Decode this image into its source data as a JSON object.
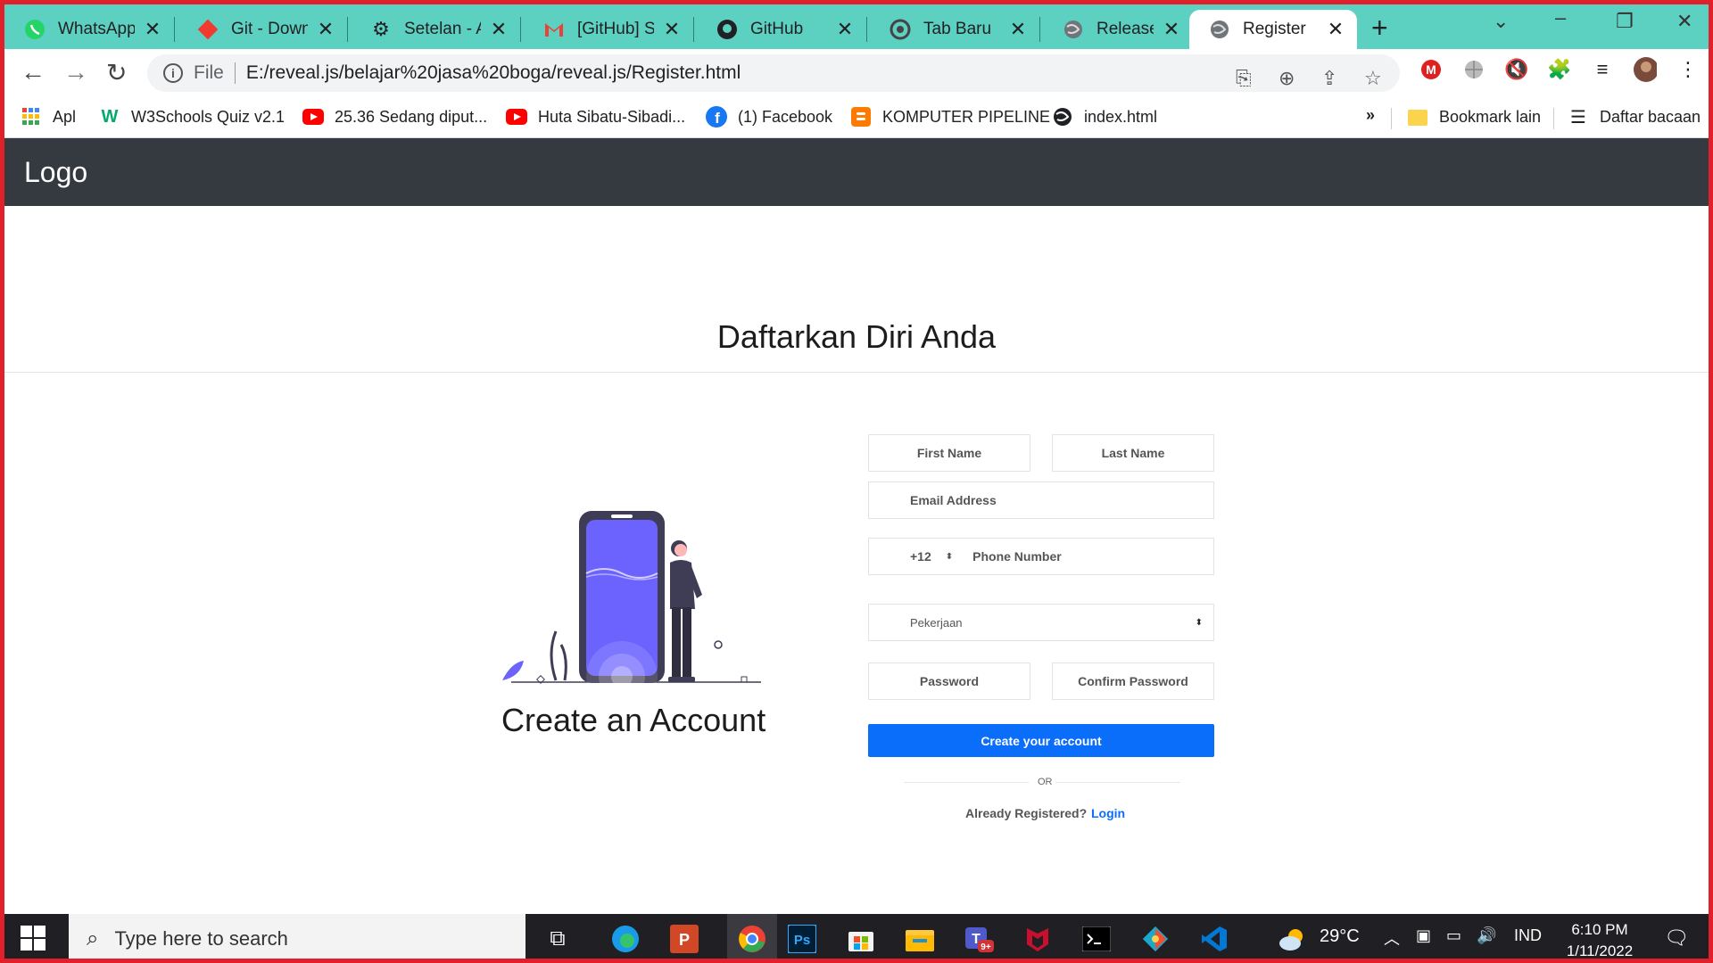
{
  "browser": {
    "tabs": [
      {
        "title": "WhatsApp",
        "icon": "whatsapp-icon"
      },
      {
        "title": "Git - Downl",
        "icon": "git-icon"
      },
      {
        "title": "Setelan - Al",
        "icon": "settings-gear-icon"
      },
      {
        "title": "[GitHub] Si",
        "icon": "gmail-icon"
      },
      {
        "title": "GitHub",
        "icon": "github-icon"
      },
      {
        "title": "Tab Baru",
        "icon": "chrome-icon"
      },
      {
        "title": "ReleaseNot",
        "icon": "globe-icon"
      },
      {
        "title": "Register",
        "icon": "globe-icon",
        "active": true
      }
    ],
    "new_tab_label": "+",
    "address": {
      "scheme_label": "File",
      "url": "E:/reveal.js/belajar%20jasa%20boga/reveal.js/Register.html"
    },
    "bookmarks": [
      {
        "label": "Apl",
        "icon": "apps-grid-icon"
      },
      {
        "label": "W3Schools Quiz v2.1",
        "icon": "w3schools-icon"
      },
      {
        "label": "25.36 Sedang diput...",
        "icon": "youtube-icon"
      },
      {
        "label": "Huta Sibatu-Sibadi...",
        "icon": "youtube-icon"
      },
      {
        "label": "(1) Facebook",
        "icon": "facebook-icon"
      },
      {
        "label": "KOMPUTER PIPELINE",
        "icon": "blogger-icon"
      },
      {
        "label": "index.html",
        "icon": "globe-icon"
      }
    ],
    "bookmarks_more": "»",
    "other_bookmarks": "Bookmark lain",
    "reading_list": "Daftar bacaan"
  },
  "site": {
    "logo": "Logo",
    "heading": "Daftarkan Diri Anda",
    "illustration_caption": "Create an Account",
    "form": {
      "first_name": "First Name",
      "last_name": "Last Name",
      "email": "Email Address",
      "country_code": "+12",
      "phone": "Phone Number",
      "job_select": "Pekerjaan",
      "password": "Password",
      "confirm_password": "Confirm Password",
      "submit": "Create your account",
      "or": "OR",
      "already": "Already Registered?",
      "login": "Login"
    }
  },
  "taskbar": {
    "search_placeholder": "Type here to search",
    "weather": "29°C",
    "language": "IND",
    "time": "6:10 PM",
    "date": "1/11/2022",
    "teams_badge": "9+"
  },
  "colors": {
    "tab_strip": "#5cd0c1",
    "navbar": "#343a40",
    "primary": "#0a6efb",
    "illustration": "#6c63ff",
    "frame": "#e0202a"
  }
}
